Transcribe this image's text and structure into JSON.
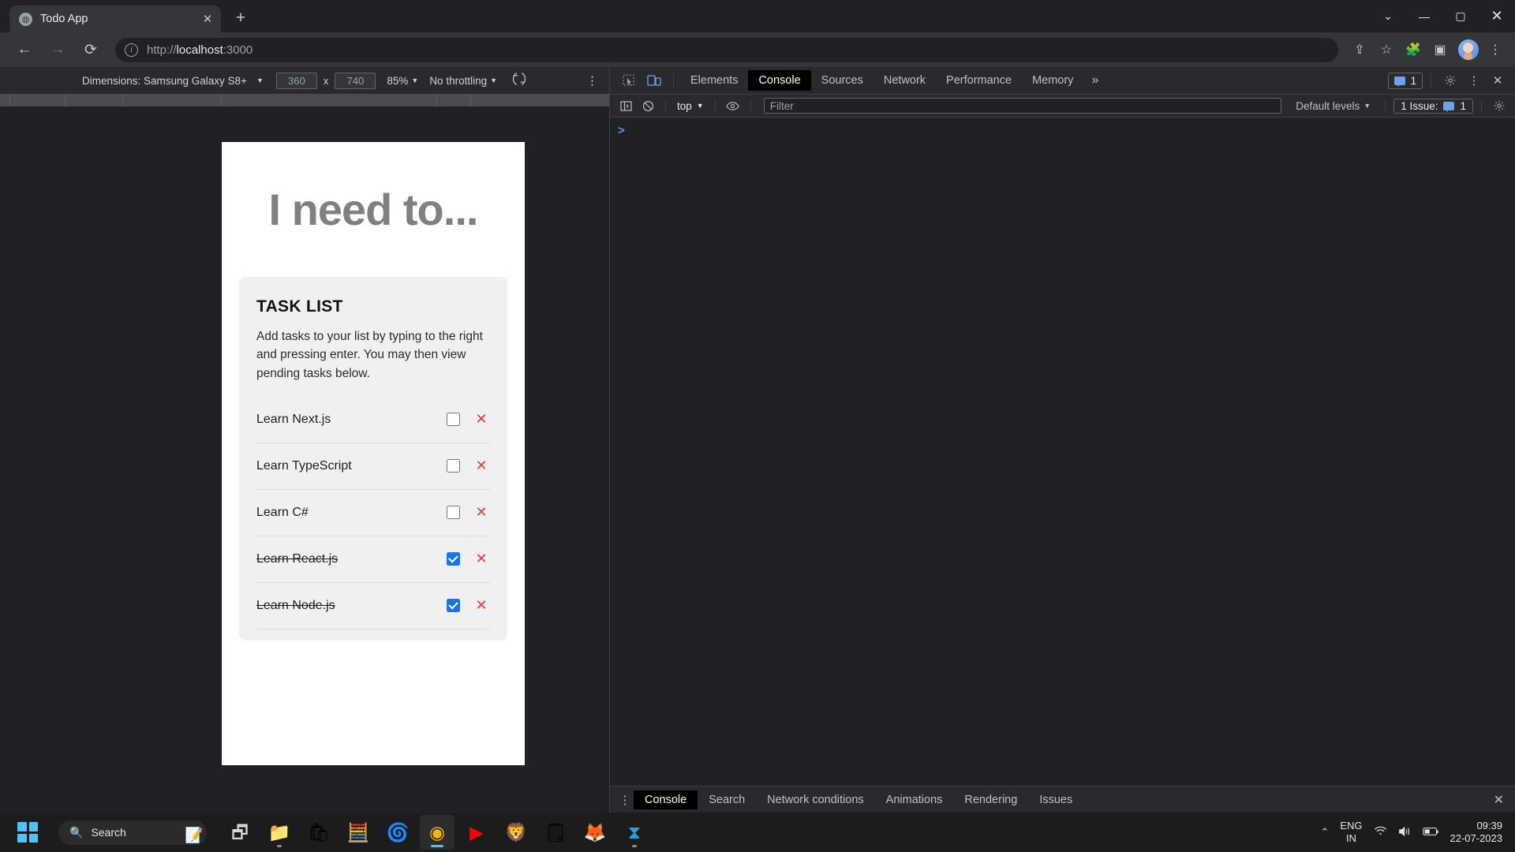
{
  "browser": {
    "tab": {
      "title": "Todo App",
      "favicon": "globe-icon",
      "close_label": "✕"
    },
    "new_tab_label": "+",
    "window_controls": {
      "minimize": "—",
      "maximize": "▢",
      "close": "✕",
      "chevron": "⌄"
    },
    "nav": {
      "back": "←",
      "forward": "→",
      "reload": "⟳"
    },
    "omnibox": {
      "info_icon": "ⓘ",
      "url_scheme": "http://",
      "url_host": "localhost",
      "url_port": ":3000",
      "full_url": "http://localhost:3000"
    },
    "toolbar_icons": {
      "share": "⇪",
      "bookmark": "☆",
      "extensions": "🧩",
      "sidepanel": "▣",
      "menu": "⋮"
    }
  },
  "device_bar": {
    "dimensions_label": "Dimensions: Samsung Galaxy S8+",
    "width": "360",
    "multiply": "x",
    "height": "740",
    "zoom": "85%",
    "throttling": "No throttling",
    "rotate_icon": "rotate-icon",
    "kebab": "⋮",
    "caret": "▼"
  },
  "app": {
    "heading": "I need to...",
    "card": {
      "title": "TASK LIST",
      "description": "Add tasks to your list by typing to the right and pressing enter. You may then view pending tasks below."
    },
    "tasks": [
      {
        "label": "Learn Next.js",
        "done": false
      },
      {
        "label": "Learn TypeScript",
        "done": false
      },
      {
        "label": "Learn C#",
        "done": false
      },
      {
        "label": "Learn React.js",
        "done": true
      },
      {
        "label": "Learn Node.js",
        "done": true
      }
    ],
    "delete_glyph": "✕",
    "accent_color": "#1a73e8",
    "delete_color": "#e53935"
  },
  "devtools": {
    "tool_icons": {
      "inspect": "inspect-icon",
      "device": "device-toggle-icon"
    },
    "tabs": [
      {
        "label": "Elements",
        "active": false
      },
      {
        "label": "Console",
        "active": true
      },
      {
        "label": "Sources",
        "active": false
      },
      {
        "label": "Network",
        "active": false
      },
      {
        "label": "Performance",
        "active": false
      },
      {
        "label": "Memory",
        "active": false
      }
    ],
    "more_tabs": "»",
    "message_count": "1",
    "settings_icon": "gear-icon",
    "kebab_icon": "⋮",
    "close_icon": "✕",
    "filter_bar": {
      "sidebar_icon": "sidebar-toggle-icon",
      "clear_icon": "clear-console-icon",
      "context": "top",
      "caret": "▼",
      "eye_icon": "live-expression-icon",
      "filter_placeholder": "Filter",
      "levels": "Default levels",
      "issues_label": "1 Issue:",
      "issues_count": "1",
      "settings_icon": "gear-icon"
    },
    "prompt": ">",
    "drawer_tabs": [
      {
        "label": "Console",
        "active": true
      },
      {
        "label": "Search",
        "active": false
      },
      {
        "label": "Network conditions",
        "active": false
      },
      {
        "label": "Animations",
        "active": false
      },
      {
        "label": "Rendering",
        "active": false
      },
      {
        "label": "Issues",
        "active": false
      }
    ],
    "drawer_kebab": "⋮",
    "drawer_close": "✕"
  },
  "taskbar": {
    "start_label": "start-button",
    "search_placeholder": "Search",
    "search_icon": "🔍",
    "apps": [
      {
        "name": "task-view",
        "glyph": "🗗",
        "running": false,
        "active": false
      },
      {
        "name": "file-explorer",
        "glyph": "📁",
        "running": true,
        "active": false
      },
      {
        "name": "microsoft-store",
        "glyph": "🛍",
        "running": false,
        "active": false
      },
      {
        "name": "calculator",
        "glyph": "🧮",
        "running": false,
        "active": false
      },
      {
        "name": "microsoft-edge",
        "glyph": "🌀",
        "running": false,
        "active": false
      },
      {
        "name": "google-chrome",
        "glyph": "◉",
        "running": true,
        "active": true
      },
      {
        "name": "youtube",
        "glyph": "▶",
        "running": false,
        "active": false
      },
      {
        "name": "brave-browser",
        "glyph": "🦁",
        "running": false,
        "active": false
      },
      {
        "name": "notepad",
        "glyph": "🗒",
        "running": false,
        "active": false
      },
      {
        "name": "firefox",
        "glyph": "🦊",
        "running": false,
        "active": false
      },
      {
        "name": "visual-studio-code",
        "glyph": "⧗",
        "running": true,
        "active": false
      }
    ],
    "tray": {
      "chevron": "⌃",
      "language_line1": "ENG",
      "language_line2": "IN",
      "wifi_icon": "📶",
      "volume_icon": "🔊",
      "battery_icon": "🔋",
      "time": "09:39",
      "date": "22-07-2023"
    }
  }
}
